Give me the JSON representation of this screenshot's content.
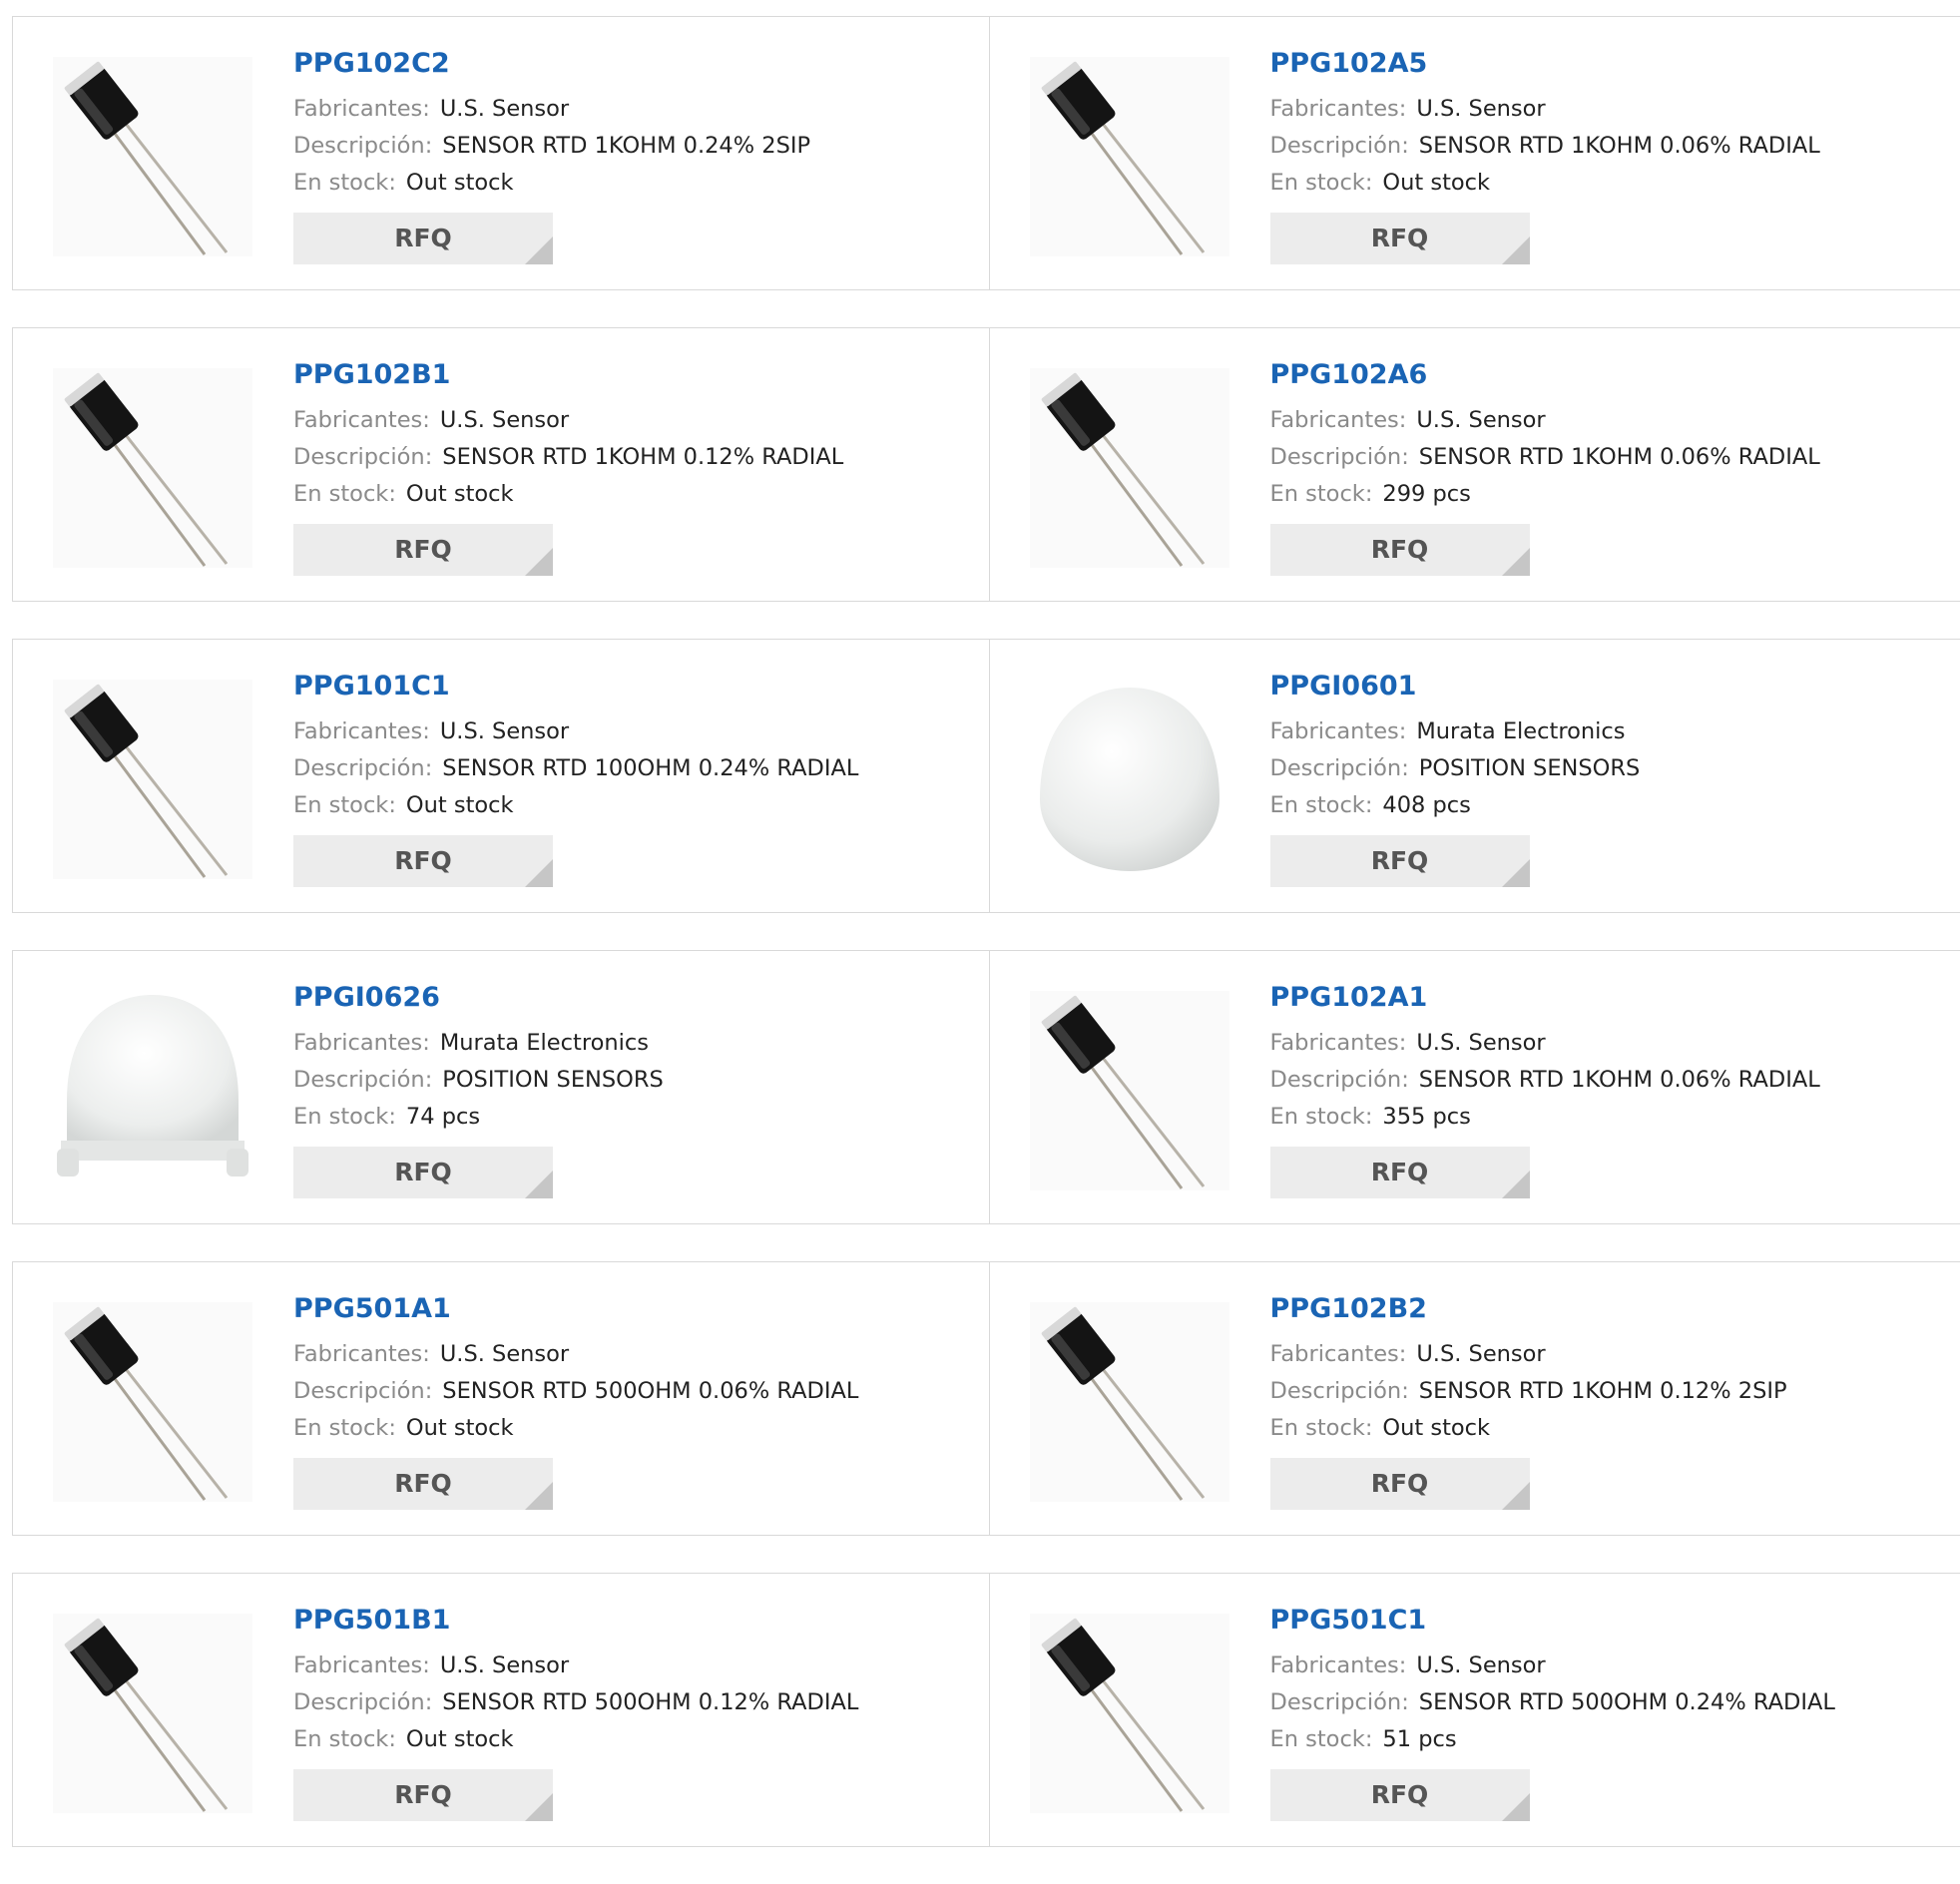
{
  "labels": {
    "manufacturer": "Fabricantes:",
    "description": "Descripción:",
    "stock": "En stock:",
    "rfq": "RFQ"
  },
  "products": [
    {
      "part": "PPG102C2",
      "mfr": "U.S. Sensor",
      "desc": "SENSOR RTD 1KOHM 0.24% 2SIP",
      "stock": "Out stock",
      "image": "rtd-sensor"
    },
    {
      "part": "PPG102A5",
      "mfr": "U.S. Sensor",
      "desc": "SENSOR RTD 1KOHM 0.06% RADIAL",
      "stock": "Out stock",
      "image": "rtd-sensor"
    },
    {
      "part": "PPG102B1",
      "mfr": "U.S. Sensor",
      "desc": "SENSOR RTD 1KOHM 0.12% RADIAL",
      "stock": "Out stock",
      "image": "rtd-sensor"
    },
    {
      "part": "PPG102A6",
      "mfr": "U.S. Sensor",
      "desc": "SENSOR RTD 1KOHM 0.06% RADIAL",
      "stock": "299 pcs",
      "image": "rtd-sensor"
    },
    {
      "part": "PPG101C1",
      "mfr": "U.S. Sensor",
      "desc": "SENSOR RTD 100OHM 0.24% RADIAL",
      "stock": "Out stock",
      "image": "rtd-sensor"
    },
    {
      "part": "PPGI0601",
      "mfr": "Murata Electronics",
      "desc": "POSITION SENSORS",
      "stock": "408 pcs",
      "image": "dome-lens"
    },
    {
      "part": "PPGI0626",
      "mfr": "Murata Electronics",
      "desc": "POSITION SENSORS",
      "stock": "74 pcs",
      "image": "dome-lens-legs"
    },
    {
      "part": "PPG102A1",
      "mfr": "U.S. Sensor",
      "desc": "SENSOR RTD 1KOHM 0.06% RADIAL",
      "stock": "355 pcs",
      "image": "rtd-sensor"
    },
    {
      "part": "PPG501A1",
      "mfr": "U.S. Sensor",
      "desc": "SENSOR RTD 500OHM 0.06% RADIAL",
      "stock": "Out stock",
      "image": "rtd-sensor"
    },
    {
      "part": "PPG102B2",
      "mfr": "U.S. Sensor",
      "desc": "SENSOR RTD 1KOHM 0.12% 2SIP",
      "stock": "Out stock",
      "image": "rtd-sensor"
    },
    {
      "part": "PPG501B1",
      "mfr": "U.S. Sensor",
      "desc": "SENSOR RTD 500OHM 0.12% RADIAL",
      "stock": "Out stock",
      "image": "rtd-sensor"
    },
    {
      "part": "PPG501C1",
      "mfr": "U.S. Sensor",
      "desc": "SENSOR RTD 500OHM 0.24% RADIAL",
      "stock": "51 pcs",
      "image": "rtd-sensor"
    }
  ],
  "colors": {
    "part_link": "#1a64b4",
    "label": "#8a8a8a",
    "rfq_bg": "#ececec",
    "border": "#d9d9d9"
  }
}
